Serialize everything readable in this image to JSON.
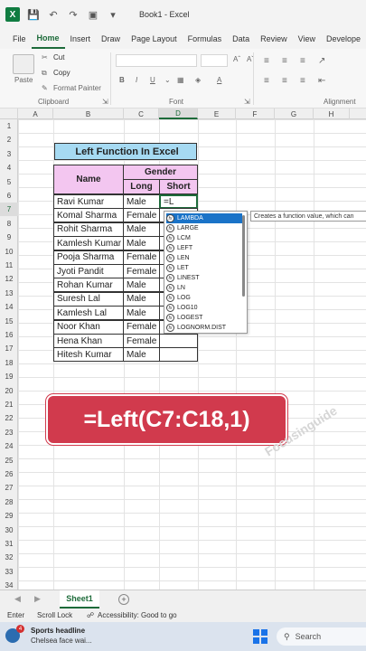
{
  "window": {
    "title": "Book1 - Excel",
    "logo": "X"
  },
  "menu": [
    "File",
    "Home",
    "Insert",
    "Draw",
    "Page Layout",
    "Formulas",
    "Data",
    "Review",
    "View",
    "Develope"
  ],
  "ribbon": {
    "paste": "Paste",
    "cut": "Cut",
    "copy": "Copy",
    "format_painter": "Format Painter",
    "clipboard": "Clipboard",
    "font": "Font",
    "alignment": "Alignment"
  },
  "columns": [
    "A",
    "B",
    "C",
    "D",
    "E",
    "F",
    "G",
    "H"
  ],
  "rows": [
    "1",
    "2",
    "3",
    "4",
    "5",
    "6",
    "7",
    "8",
    "9",
    "10",
    "11",
    "12",
    "13",
    "14",
    "15",
    "16",
    "17",
    "18",
    "19",
    "20",
    "21",
    "22",
    "23",
    "24",
    "25",
    "26",
    "27",
    "28",
    "29",
    "30",
    "31",
    "32",
    "33",
    "34"
  ],
  "table": {
    "title": "Left Function In Excel",
    "name_header": "Name",
    "gender_header": "Gender",
    "long_header": "Long",
    "short_header": "Short",
    "editing_value": "=L",
    "rows": [
      {
        "name": "Ravi Kumar",
        "gender": "Male"
      },
      {
        "name": "Komal Sharma",
        "gender": "Female"
      },
      {
        "name": "Rohit Sharma",
        "gender": "Male"
      },
      {
        "name": "Kamlesh Kumar",
        "gender": "Male"
      },
      {
        "name": "Pooja Sharma",
        "gender": "Female"
      },
      {
        "name": "Jyoti Pandit",
        "gender": "Female"
      },
      {
        "name": "Rohan Kumar",
        "gender": "Male"
      },
      {
        "name": "Suresh Lal",
        "gender": "Male"
      },
      {
        "name": "Kamlesh Lal",
        "gender": "Male"
      },
      {
        "name": "Noor Khan",
        "gender": "Female"
      },
      {
        "name": "Hena Khan",
        "gender": "Female"
      },
      {
        "name": "Hitesh Kumar",
        "gender": "Male"
      }
    ]
  },
  "autocomplete": {
    "items": [
      "LAMBDA",
      "LARGE",
      "LCM",
      "LEFT",
      "LEN",
      "LET",
      "LINEST",
      "LN",
      "LOG",
      "LOG10",
      "LOGEST",
      "LOGNORM.DIST"
    ],
    "selected": 0,
    "tooltip": "Creates a function value, which can"
  },
  "banner": "=Left(C7:C18,1)",
  "watermark": "Focusinguide",
  "sheet": {
    "tab": "Sheet1",
    "add": "+"
  },
  "status": {
    "mode": "Enter",
    "scroll_lock": "Scroll Lock",
    "accessibility": "Accessibility: Good to go"
  },
  "taskbar": {
    "news_badge": "4",
    "news_headline": "Sports headline",
    "news_sub": "Chelsea face wai...",
    "search": "Search"
  },
  "colors": {
    "excel_green": "#1d6b3a",
    "header_pink": "#f3c6f0",
    "title_blue": "#a6daf2",
    "banner_red": "#d13a4d",
    "select_blue": "#1a73c8"
  }
}
